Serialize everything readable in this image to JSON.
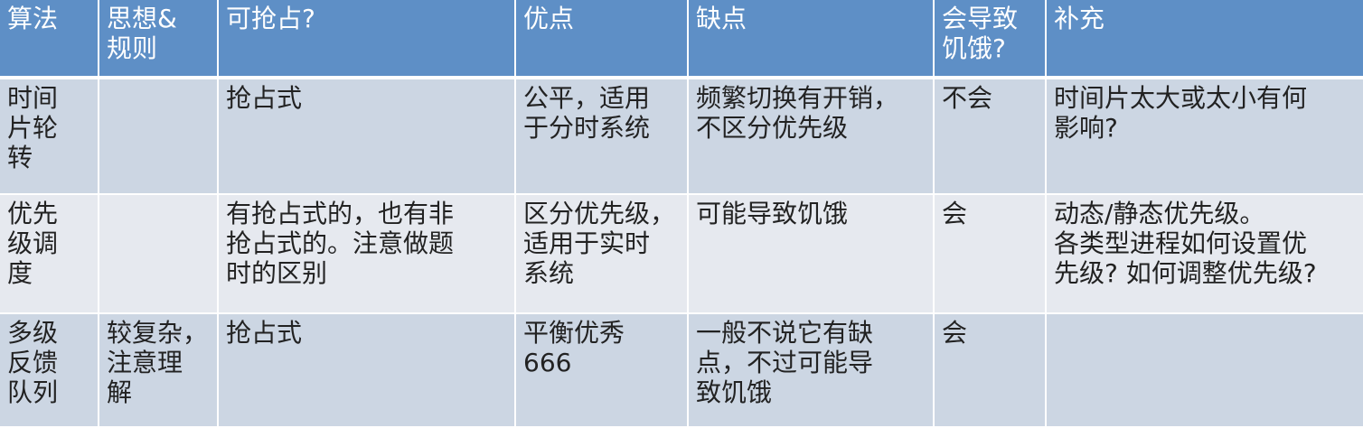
{
  "table": {
    "headers": [
      "算法",
      "思想&\n规则",
      "可抢占?",
      "优点",
      "缺点",
      "会导致\n饥饿?",
      "补充"
    ],
    "rows": [
      [
        "时间\n片轮\n转",
        "",
        "抢占式",
        "公平，适用\n于分时系统",
        "频繁切换有开销，\n不区分优先级",
        "不会",
        "时间片太大或太小有何\n影响?"
      ],
      [
        "优先\n级调\n度",
        "",
        "有抢占式的，也有非\n抢占式的。注意做题\n时的区别",
        "区分优先级，\n适用于实时\n系统",
        "可能导致饥饿",
        "会",
        "动态/静态优先级。\n各类型进程如何设置优\n先级? 如何调整优先级?"
      ],
      [
        "多级\n反馈\n队列",
        "较复杂，\n注意理\n解",
        "抢占式",
        "平衡优秀\n666",
        "一般不说它有缺\n点，不过可能导\n致饥饿",
        "会",
        ""
      ]
    ]
  },
  "colors": {
    "header_bg": "#5e8fc6",
    "row_odd_bg": "#ccd6e3",
    "row_even_bg": "#e6e9ef",
    "grid_line": "#ffffff"
  }
}
